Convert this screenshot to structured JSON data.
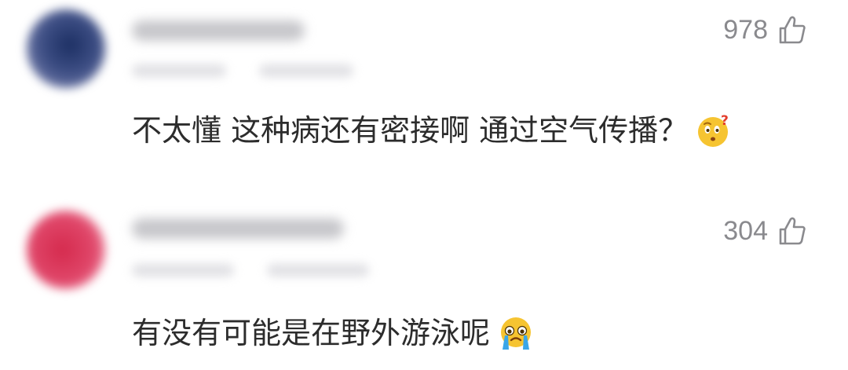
{
  "comments": [
    {
      "likes": "978",
      "text": "不太懂 这种病还有密接啊 通过空气传播？",
      "emoji": "thinking-question-face-icon"
    },
    {
      "likes": "304",
      "text": "有没有可能是在野外游泳呢",
      "emoji": "crying-face-icon"
    }
  ],
  "colors": {
    "text": "#2c2c2c",
    "meta": "#8a8a8e",
    "emoji_face": "#f6c431"
  }
}
